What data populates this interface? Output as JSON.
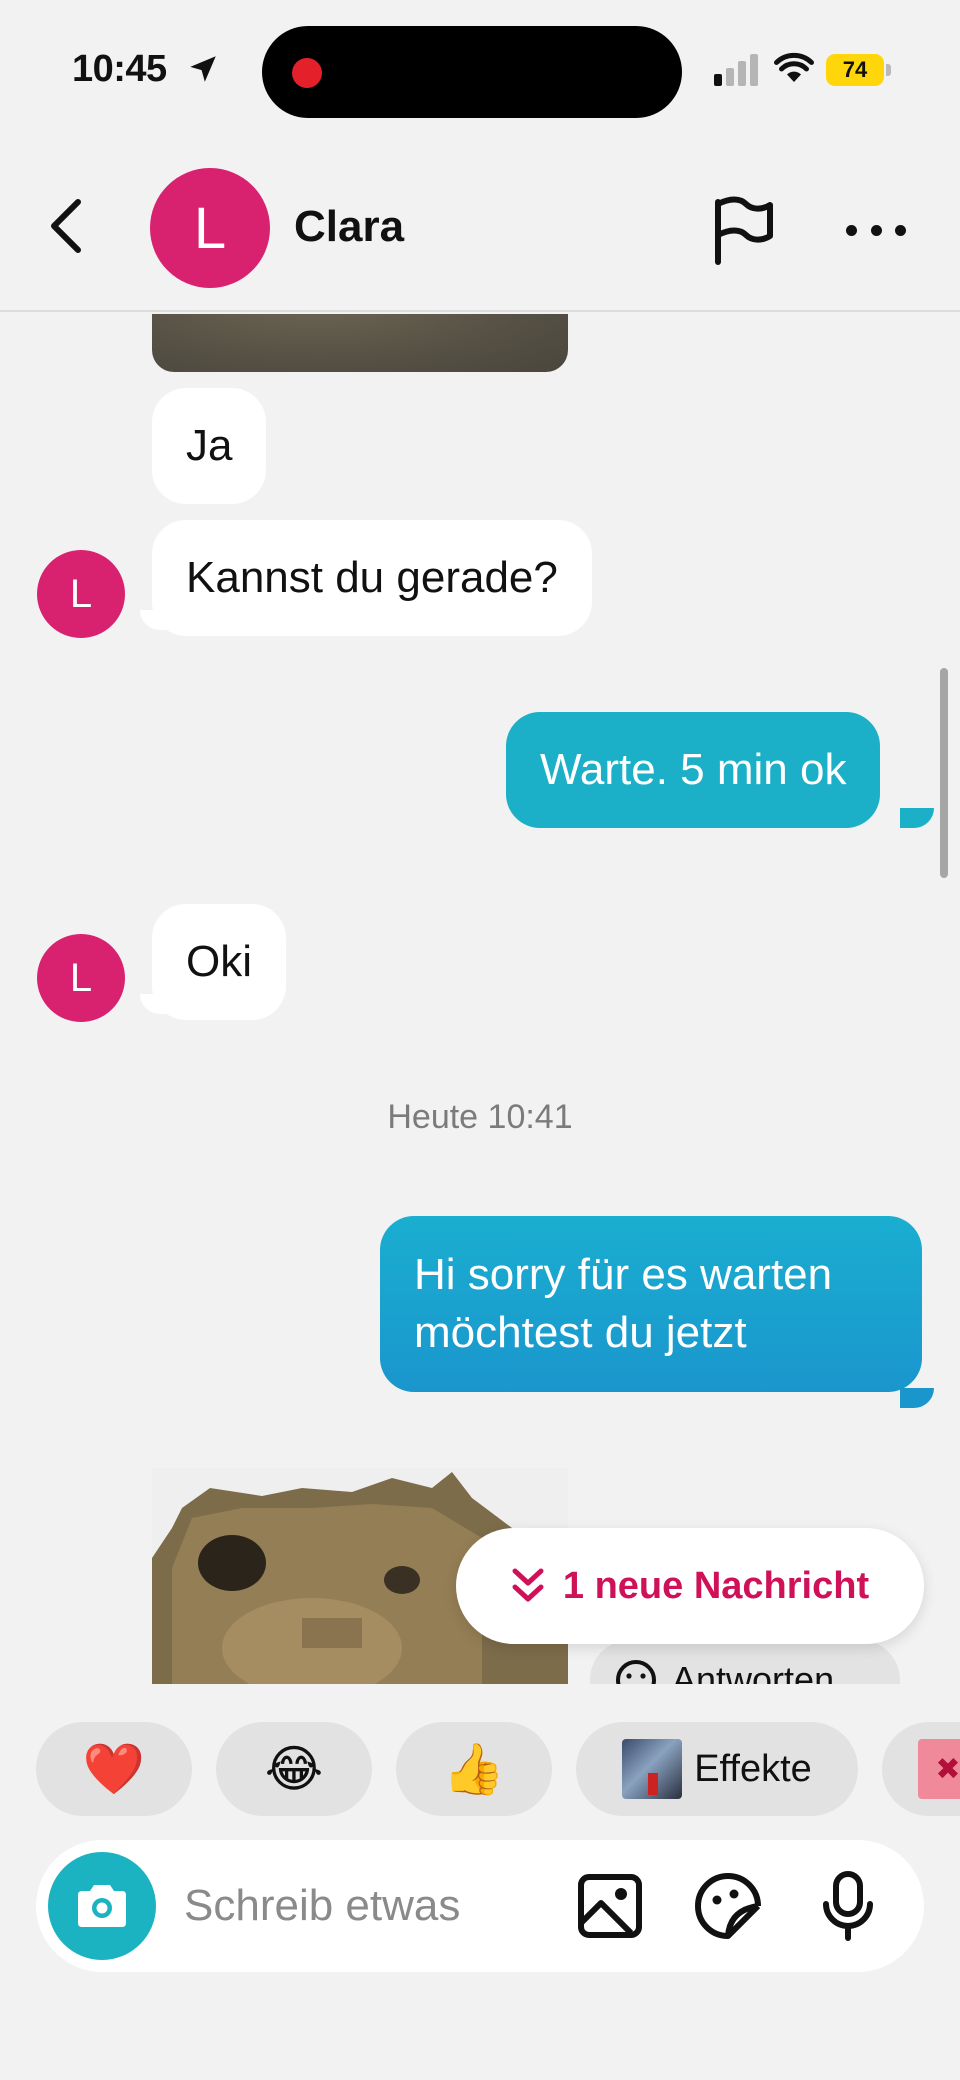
{
  "status_bar": {
    "time": "10:45",
    "battery": "74"
  },
  "header": {
    "avatar_letter": "L",
    "contact_name": "Clara"
  },
  "messages": [
    {
      "id": "m1",
      "direction": "incoming",
      "text": "Ja"
    },
    {
      "id": "m2",
      "direction": "incoming",
      "text": "Kannst du gerade?",
      "avatar_letter": "L"
    },
    {
      "id": "m3",
      "direction": "outgoing",
      "text": "Warte. 5 min ok"
    },
    {
      "id": "m4",
      "direction": "incoming",
      "text": "Oki",
      "avatar_letter": "L"
    },
    {
      "id": "m5",
      "direction": "outgoing",
      "text": "Hi sorry für es warten möchtest du jetzt"
    }
  ],
  "timestamp": "Heute 10:41",
  "new_message_pill": "1 neue Nachricht",
  "reply_chip": "Antworten",
  "reactions": [
    {
      "emoji": "❤️",
      "name": "heart"
    },
    {
      "emoji": "😂",
      "name": "laughing"
    },
    {
      "emoji": "👍",
      "name": "thumbs-up"
    }
  ],
  "effects_label": "Effekte",
  "composer": {
    "placeholder": "Schreib etwas"
  },
  "colors": {
    "accent_teal": "#1bb0c7",
    "outgoing_blue": "#1a9ecf",
    "avatar_pink": "#d8216f",
    "new_message_red": "#cf1159"
  }
}
